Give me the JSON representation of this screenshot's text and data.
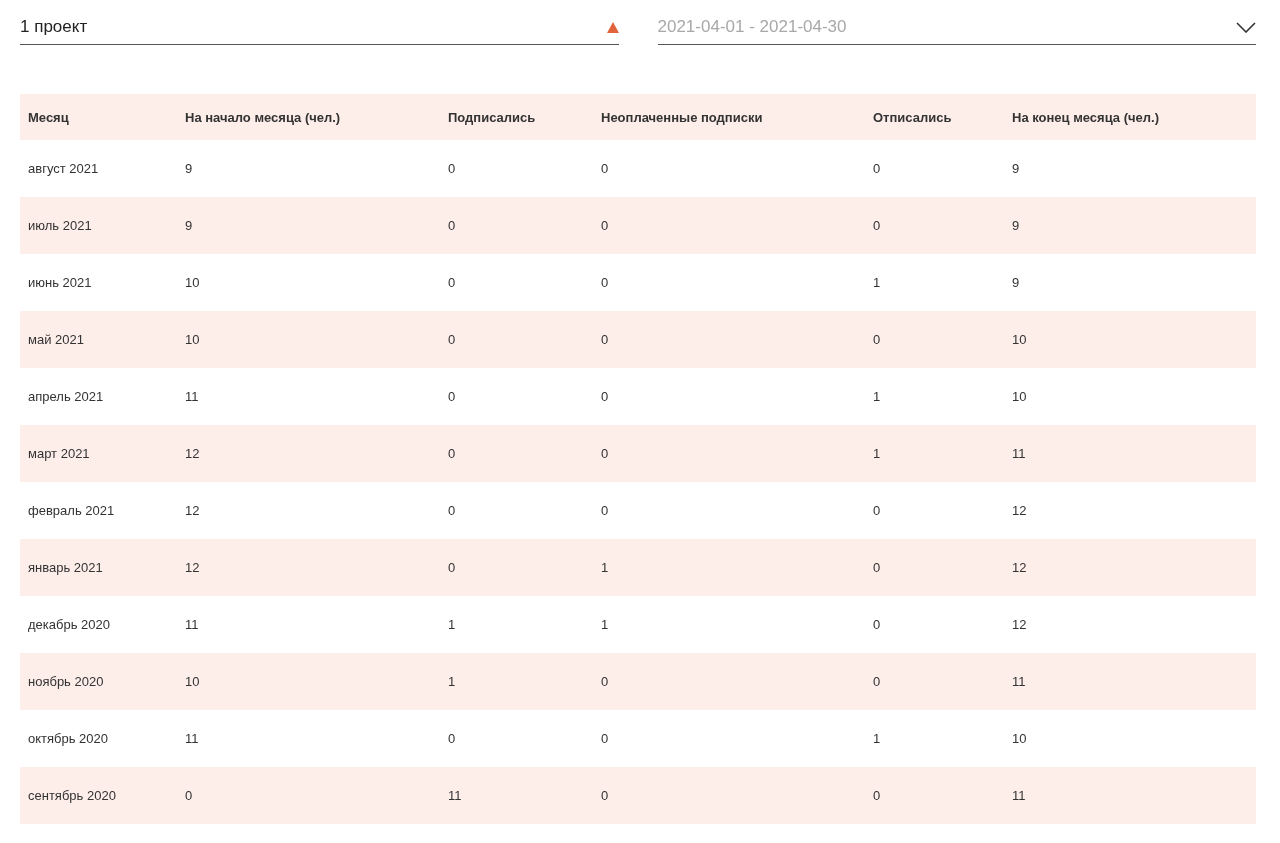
{
  "filters": {
    "project": {
      "value": "1 проект"
    },
    "period": {
      "placeholder": "2021-04-01 - 2021-04-30"
    }
  },
  "table": {
    "columns": [
      "Месяц",
      "На начало месяца (чел.)",
      "Подписались",
      "Неоплаченные подписки",
      "Отписались",
      "На конец месяца (чел.)"
    ],
    "rows": [
      [
        "август 2021",
        "9",
        "0",
        "0",
        "0",
        "9"
      ],
      [
        "июль 2021",
        "9",
        "0",
        "0",
        "0",
        "9"
      ],
      [
        "июнь 2021",
        "10",
        "0",
        "0",
        "1",
        "9"
      ],
      [
        "май 2021",
        "10",
        "0",
        "0",
        "0",
        "10"
      ],
      [
        "апрель 2021",
        "11",
        "0",
        "0",
        "1",
        "10"
      ],
      [
        "март 2021",
        "12",
        "0",
        "0",
        "1",
        "11"
      ],
      [
        "февраль 2021",
        "12",
        "0",
        "0",
        "0",
        "12"
      ],
      [
        "январь 2021",
        "12",
        "0",
        "1",
        "0",
        "12"
      ],
      [
        "декабрь 2020",
        "11",
        "1",
        "1",
        "0",
        "12"
      ],
      [
        "ноябрь 2020",
        "10",
        "1",
        "0",
        "0",
        "11"
      ],
      [
        "октябрь 2020",
        "11",
        "0",
        "0",
        "1",
        "10"
      ],
      [
        "сентябрь 2020",
        "0",
        "11",
        "0",
        "0",
        "11"
      ]
    ]
  }
}
